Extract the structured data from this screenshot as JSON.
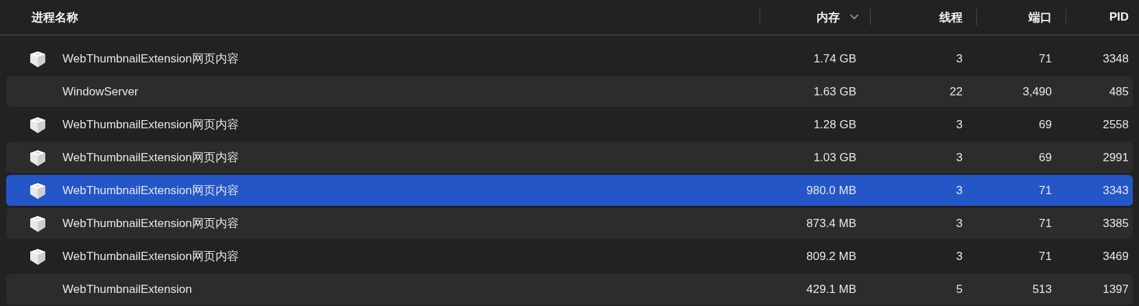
{
  "table": {
    "columns": [
      {
        "label": "进程名称",
        "sorted": false
      },
      {
        "label": "内存",
        "sorted": true
      },
      {
        "label": "线程",
        "sorted": false
      },
      {
        "label": "端口",
        "sorted": false
      },
      {
        "label": "PID",
        "sorted": false
      }
    ],
    "rows": [
      {
        "has_icon": true,
        "selected": false,
        "cells": [
          "WebThumbnailExtension网页内容",
          "1.74 GB",
          "3",
          "71",
          "3348"
        ]
      },
      {
        "has_icon": false,
        "selected": false,
        "cells": [
          "WindowServer",
          "1.63 GB",
          "22",
          "3,490",
          "485"
        ]
      },
      {
        "has_icon": true,
        "selected": false,
        "cells": [
          "WebThumbnailExtension网页内容",
          "1.28 GB",
          "3",
          "69",
          "2558"
        ]
      },
      {
        "has_icon": true,
        "selected": false,
        "cells": [
          "WebThumbnailExtension网页内容",
          "1.03 GB",
          "3",
          "69",
          "2991"
        ]
      },
      {
        "has_icon": true,
        "selected": true,
        "cells": [
          "WebThumbnailExtension网页内容",
          "980.0 MB",
          "3",
          "71",
          "3343"
        ]
      },
      {
        "has_icon": true,
        "selected": false,
        "cells": [
          "WebThumbnailExtension网页内容",
          "873.4 MB",
          "3",
          "71",
          "3385"
        ]
      },
      {
        "has_icon": true,
        "selected": false,
        "cells": [
          "WebThumbnailExtension网页内容",
          "809.2 MB",
          "3",
          "71",
          "3469"
        ]
      },
      {
        "has_icon": false,
        "selected": false,
        "cells": [
          "WebThumbnailExtension",
          "429.1 MB",
          "5",
          "513",
          "1397"
        ]
      }
    ]
  }
}
